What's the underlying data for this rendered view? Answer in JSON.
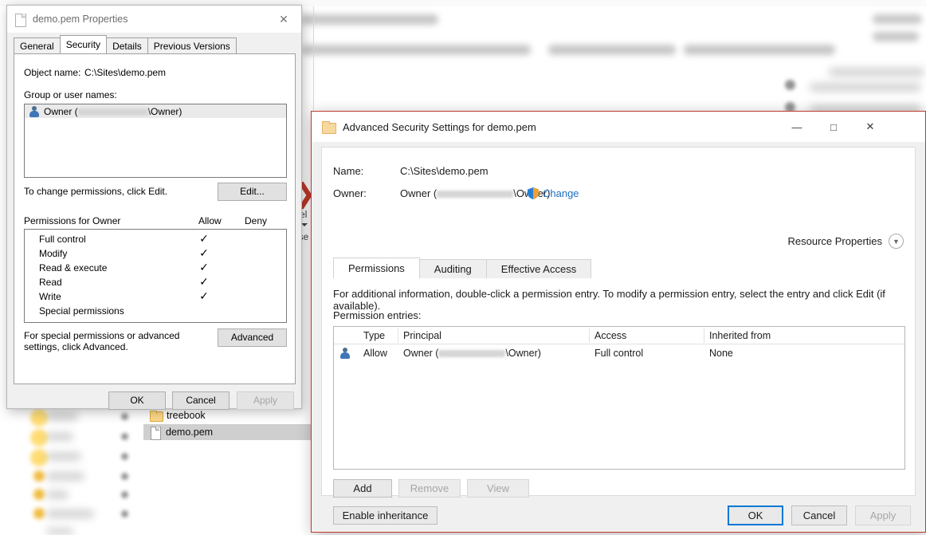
{
  "background": {
    "explorer": {
      "files": [
        {
          "name": "treebook",
          "icon": "folder-icon",
          "selected": false
        },
        {
          "name": "demo.pem",
          "icon": "document-icon",
          "selected": true
        }
      ]
    },
    "ribbon": {
      "delete_icon": "delete-arrow-icon",
      "delete_label": "Del",
      "organise_label": "nise"
    }
  },
  "properties_window": {
    "title": "demo.pem Properties",
    "title_icon": "document-icon",
    "close_icon": "close-icon",
    "tabs": [
      {
        "label": "General",
        "active": false
      },
      {
        "label": "Security",
        "active": true
      },
      {
        "label": "Details",
        "active": false
      },
      {
        "label": "Previous Versions",
        "active": false
      }
    ],
    "object_name_label": "Object name:",
    "object_name_value": "C:\\Sites\\demo.pem",
    "group_users_label": "Group or user names:",
    "user_list": [
      {
        "prefix": "Owner (",
        "redacted": true,
        "suffix": "\\Owner)",
        "icon": "user-icon",
        "selected": true
      }
    ],
    "change_hint": "To change permissions, click Edit.",
    "edit_button": "Edit...",
    "permissions_header": "Permissions for Owner",
    "allow_column": "Allow",
    "deny_column": "Deny",
    "permissions": [
      {
        "name": "Full control",
        "allow": "✓",
        "deny": ""
      },
      {
        "name": "Modify",
        "allow": "✓",
        "deny": ""
      },
      {
        "name": "Read & execute",
        "allow": "✓",
        "deny": ""
      },
      {
        "name": "Read",
        "allow": "✓",
        "deny": ""
      },
      {
        "name": "Write",
        "allow": "✓",
        "deny": ""
      },
      {
        "name": "Special permissions",
        "allow": "",
        "deny": ""
      }
    ],
    "special_note": "For special permissions or advanced settings, click Advanced.",
    "advanced_button": "Advanced",
    "ok_button": "OK",
    "cancel_button": "Cancel",
    "apply_button": "Apply"
  },
  "advanced_window": {
    "title": "Advanced Security Settings for demo.pem",
    "title_icon": "folder-icon",
    "minimize_icon": "minimize-icon",
    "maximize_icon": "maximize-icon",
    "close_icon": "close-icon",
    "border_color": "#c0392b",
    "name_label": "Name:",
    "name_value": "C:\\Sites\\demo.pem",
    "owner_label": "Owner:",
    "owner_prefix": "Owner (",
    "owner_suffix": "\\Owner)",
    "change_link": "Change",
    "change_icon": "shield-icon",
    "resource_properties_label": "Resource Properties",
    "resource_properties_icon": "chevron-down-icon",
    "tabs": [
      {
        "label": "Permissions",
        "active": true
      },
      {
        "label": "Auditing",
        "active": false
      },
      {
        "label": "Effective Access",
        "active": false
      }
    ],
    "info_text": "For additional information, double-click a permission entry. To modify a permission entry, select the entry and click Edit (if available).",
    "entries_label": "Permission entries:",
    "table": {
      "columns": [
        "Type",
        "Principal",
        "Access",
        "Inherited from"
      ],
      "rows": [
        {
          "icon": "user-icon",
          "type": "Allow",
          "principal_prefix": "Owner (",
          "principal_suffix": "\\Owner)",
          "access": "Full control",
          "inherited_from": "None"
        }
      ]
    },
    "add_button": "Add",
    "remove_button": "Remove",
    "view_button": "View",
    "enable_inheritance_button": "Enable inheritance",
    "ok_button": "OK",
    "cancel_button": "Cancel",
    "apply_button": "Apply"
  }
}
